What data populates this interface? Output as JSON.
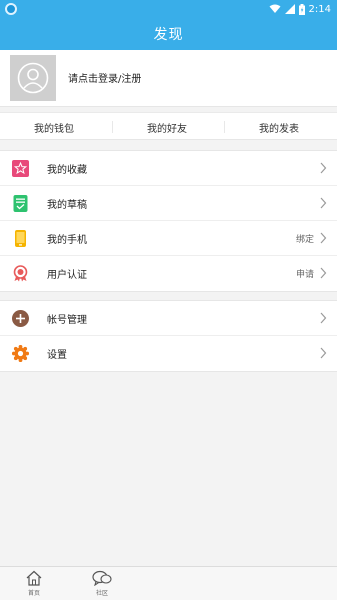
{
  "status_bar": {
    "time": "2:14",
    "wifi_icon": "wifi-icon",
    "signal_icon": "signal-icon",
    "battery_icon": "battery-icon"
  },
  "header": {
    "title": "发现"
  },
  "profile": {
    "login_text": "请点击登录/注册",
    "avatar_icon": "avatar-icon"
  },
  "tabs": [
    {
      "label": "我的钱包"
    },
    {
      "label": "我的好友"
    },
    {
      "label": "我的发表"
    }
  ],
  "menu_group_1": [
    {
      "label": "我的收藏",
      "value": "",
      "icon": "star-icon",
      "color": "#e8497a"
    },
    {
      "label": "我的草稿",
      "value": "",
      "icon": "draft-icon",
      "color": "#2ec26f"
    },
    {
      "label": "我的手机",
      "value": "绑定",
      "icon": "phone-icon",
      "color": "#f5b400"
    },
    {
      "label": "用户认证",
      "value": "申请",
      "icon": "badge-icon",
      "color": "#e85a5a"
    }
  ],
  "menu_group_2": [
    {
      "label": "帐号管理",
      "value": "",
      "icon": "account-plus-icon",
      "color": "#8a5a44"
    },
    {
      "label": "设置",
      "value": "",
      "icon": "settings-icon",
      "color": "#f07a14"
    }
  ],
  "bottom_nav": [
    {
      "label": "首页",
      "icon": "home-icon"
    },
    {
      "label": "社区",
      "icon": "community-icon"
    }
  ],
  "colors": {
    "brand": "#39aee9",
    "background": "#f3f3f3"
  }
}
